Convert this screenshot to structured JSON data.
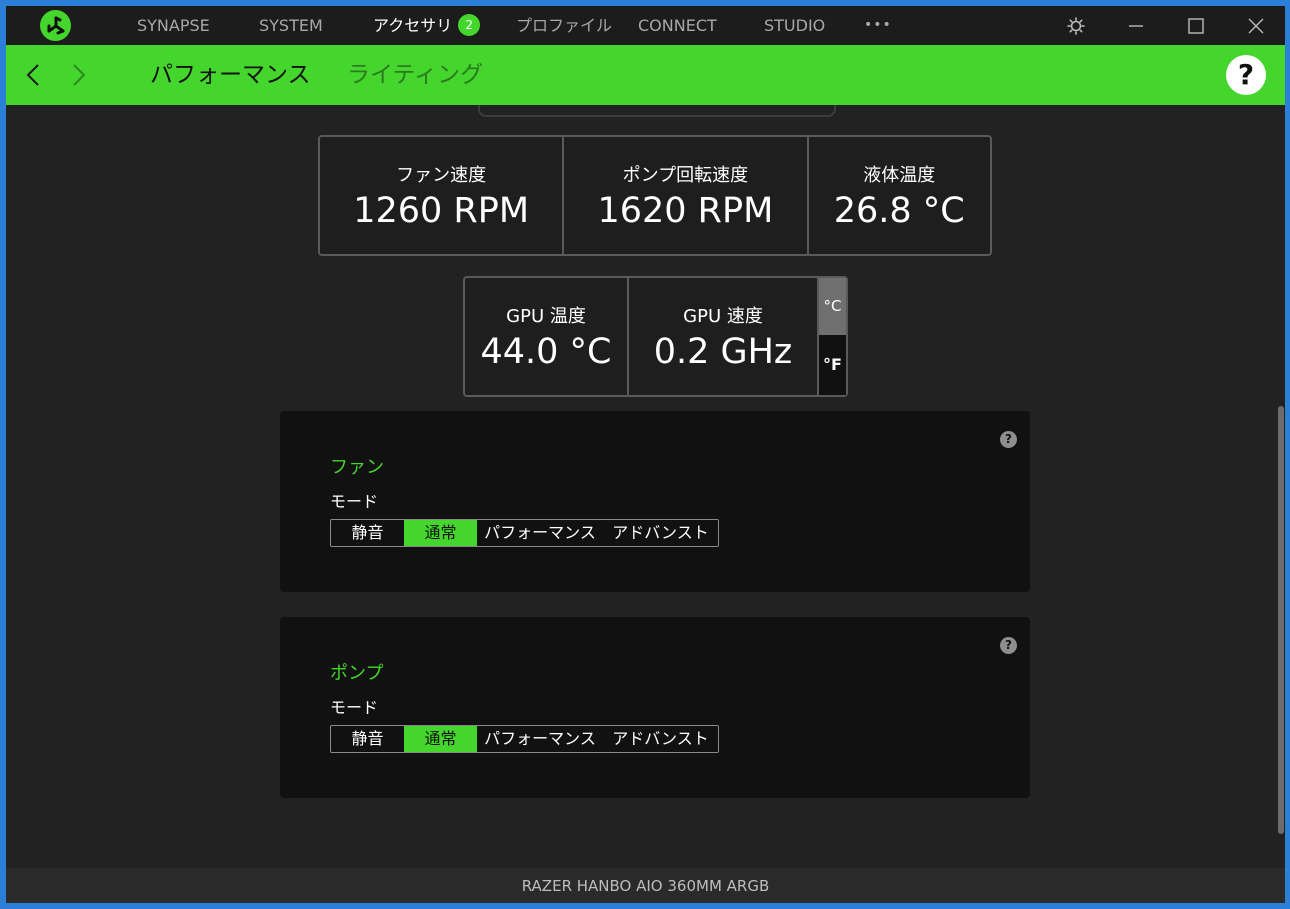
{
  "topnav": {
    "items": [
      {
        "label": "SYNAPSE"
      },
      {
        "label": "SYSTEM"
      },
      {
        "label": "アクセサリ",
        "badge": "2"
      },
      {
        "label": "プロファイル"
      },
      {
        "label": "CONNECT"
      },
      {
        "label": "STUDIO"
      }
    ],
    "more_label": "•••",
    "icons": [
      "razer-logo-icon",
      "settings-gear-icon",
      "minimize-icon",
      "maximize-icon",
      "close-icon"
    ]
  },
  "subnav": {
    "tabs": [
      {
        "label": "パフォーマンス"
      },
      {
        "label": "ライティング"
      }
    ],
    "help_label": "?",
    "icons": [
      "back-arrow-icon",
      "forward-arrow-icon",
      "help-icon"
    ]
  },
  "stats": {
    "top": [
      {
        "label": "ファン速度",
        "value": "1260 RPM"
      },
      {
        "label": "ポンプ回転速度",
        "value": "1620 RPM"
      },
      {
        "label": "液体温度",
        "value": "26.8 °C"
      }
    ],
    "gpu": [
      {
        "label": "GPU 温度",
        "value": "44.0 °C"
      },
      {
        "label": "GPU 速度",
        "value": "0.2 GHz"
      }
    ],
    "unit_toggle": {
      "celsius": "°C",
      "fahrenheit": "°F"
    }
  },
  "panels": [
    {
      "title": "ファン",
      "mode_label": "モード",
      "help_label": "?",
      "options": [
        "静音",
        "通常",
        "パフォーマンス",
        "アドバンスト"
      ],
      "selected": "通常"
    },
    {
      "title": "ポンプ",
      "mode_label": "モード",
      "help_label": "?",
      "options": [
        "静音",
        "通常",
        "パフォーマンス",
        "アドバンスト"
      ],
      "selected": "通常"
    }
  ],
  "footer": {
    "device_name": "RAZER HANBO AIO 360MM ARGB"
  },
  "colors": {
    "accent": "#44d62c",
    "background": "#222222",
    "panel": "#111111",
    "titlebar": "#1c1c1c"
  }
}
